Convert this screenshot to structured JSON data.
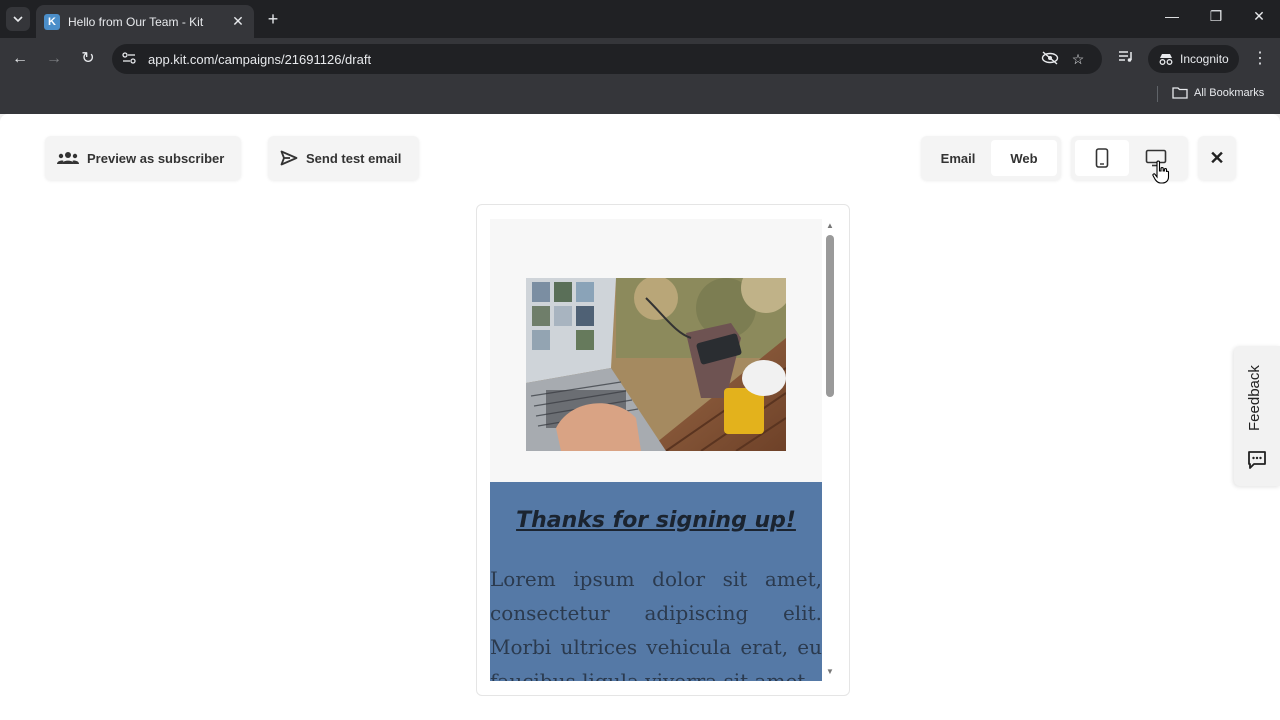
{
  "browser": {
    "tab_title": "Hello from Our Team - Kit",
    "favicon_letter": "K",
    "url": "app.kit.com/campaigns/21691126/draft",
    "incognito_label": "Incognito",
    "all_bookmarks_label": "All Bookmarks"
  },
  "toolbar": {
    "preview_label": "Preview as subscriber",
    "send_test_label": "Send test email",
    "view_tabs": [
      {
        "label": "Email",
        "active": false
      },
      {
        "label": "Web",
        "active": true
      }
    ],
    "device": {
      "mobile_active": false,
      "desktop_active": true
    },
    "close_symbol": "✕"
  },
  "email": {
    "heading": "Thanks for signing up!",
    "body": "Lorem ipsum dolor sit amet, consectetur adipiscing elit. Morbi ultrices vehicula erat, eu faucibus ligula viverra sit amet.",
    "block_color": "#5579a6"
  },
  "feedback": {
    "label": "Feedback"
  }
}
